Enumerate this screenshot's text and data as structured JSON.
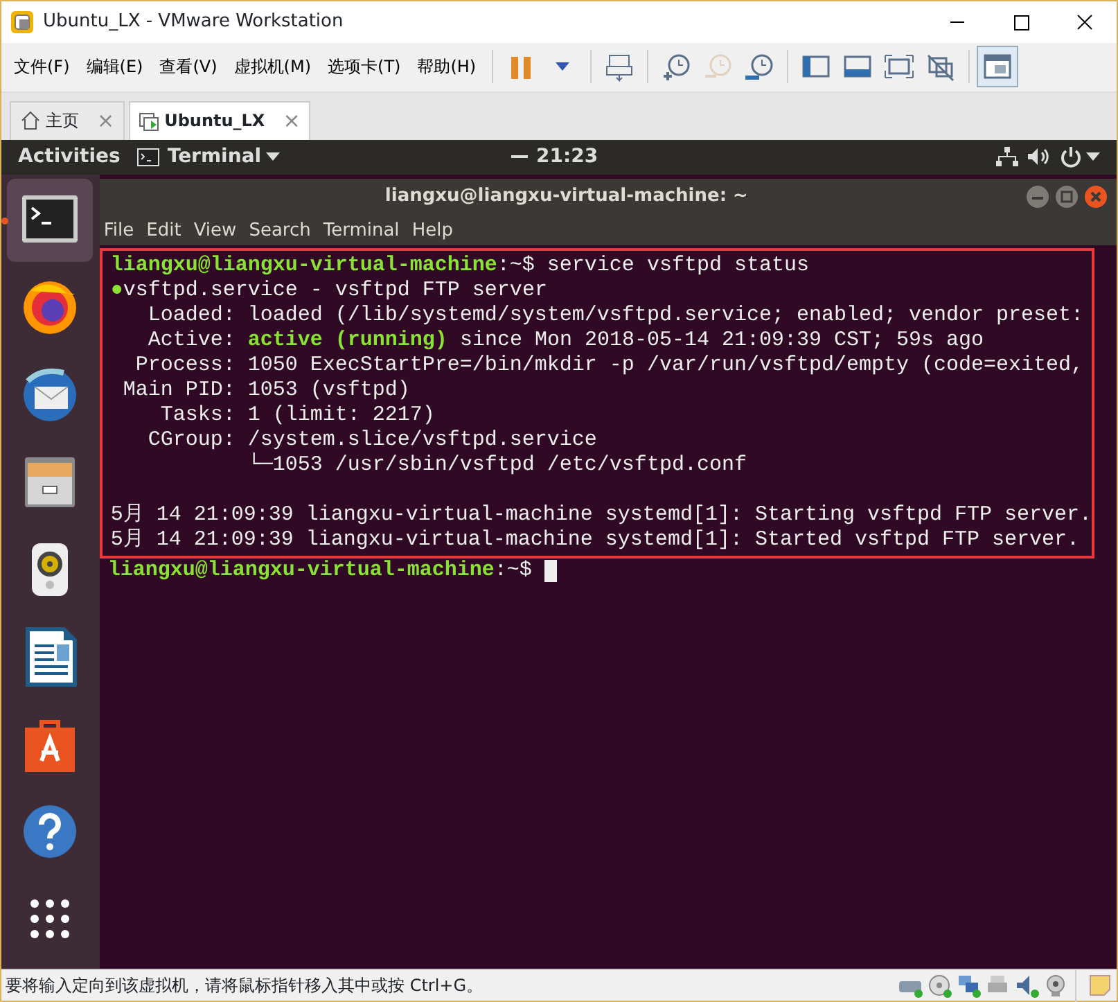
{
  "window": {
    "title": "Ubuntu_LX - VMware Workstation"
  },
  "menu": [
    "文件(F)",
    "编辑(E)",
    "查看(V)",
    "虚拟机(M)",
    "选项卡(T)",
    "帮助(H)"
  ],
  "toolbar": [
    {
      "kind": "pause",
      "disabled": false,
      "pressed": false
    },
    {
      "kind": "caret",
      "disabled": false,
      "pressed": false
    },
    {
      "kind": "send",
      "disabled": false,
      "pressed": false
    },
    {
      "kind": "snapshot",
      "disabled": false,
      "pressed": false
    },
    {
      "kind": "revert",
      "disabled": true,
      "pressed": false
    },
    {
      "kind": "manage",
      "disabled": false,
      "pressed": false
    },
    {
      "kind": "sidebar",
      "disabled": false,
      "pressed": false
    },
    {
      "kind": "console",
      "disabled": false,
      "pressed": false
    },
    {
      "kind": "fullscreen",
      "disabled": false,
      "pressed": false
    },
    {
      "kind": "unity",
      "disabled": false,
      "pressed": false
    },
    {
      "kind": "library",
      "disabled": false,
      "pressed": true
    }
  ],
  "tabs": [
    {
      "kind": "home",
      "label": "主页",
      "close": "×",
      "selected": false
    },
    {
      "kind": "vm",
      "label": "Ubuntu_LX",
      "close": "×",
      "selected": true
    }
  ],
  "topbar": {
    "activities": "Activities",
    "app": "Terminal",
    "clock": "21:23"
  },
  "dock": [
    {
      "kind": "terminal",
      "selected": true
    },
    {
      "kind": "firefox",
      "selected": false
    },
    {
      "kind": "mail",
      "selected": false
    },
    {
      "kind": "files",
      "selected": false
    },
    {
      "kind": "speaker",
      "selected": false
    },
    {
      "kind": "writer",
      "selected": false
    },
    {
      "kind": "store",
      "selected": false
    },
    {
      "kind": "help",
      "selected": false
    },
    {
      "kind": "grid",
      "selected": false
    }
  ],
  "terminal": {
    "title": "liangxu@liangxu-virtual-machine: ~",
    "menu": [
      "File",
      "Edit",
      "View",
      "Search",
      "Terminal",
      "Help"
    ],
    "highlighted": [
      {
        "kind": "text",
        "segments": [
          {
            "kind": "prompt",
            "text": "liangxu@liangxu-virtual-machine"
          },
          {
            "kind": "plain",
            "text": ":~$ service vsftpd status"
          }
        ]
      },
      {
        "kind": "text",
        "segments": [
          {
            "kind": "ok",
            "text": "●"
          },
          {
            "kind": "plain",
            "text": "vsftpd.service - vsftpd FTP server"
          }
        ]
      },
      {
        "kind": "text",
        "segments": [
          {
            "kind": "plain",
            "text": "   Loaded: loaded (/lib/systemd/system/vsftpd.service; enabled; vendor preset:"
          }
        ]
      },
      {
        "kind": "text",
        "segments": [
          {
            "kind": "plain",
            "text": "   Active: "
          },
          {
            "kind": "ok",
            "text": "active (running)"
          },
          {
            "kind": "plain",
            "text": " since Mon 2018-05-14 21:09:39 CST; 59s ago"
          }
        ]
      },
      {
        "kind": "text",
        "segments": [
          {
            "kind": "plain",
            "text": "  Process: 1050 ExecStartPre=/bin/mkdir -p /var/run/vsftpd/empty (code=exited,"
          }
        ]
      },
      {
        "kind": "text",
        "segments": [
          {
            "kind": "plain",
            "text": " Main PID: 1053 (vsftpd)"
          }
        ]
      },
      {
        "kind": "text",
        "segments": [
          {
            "kind": "plain",
            "text": "    Tasks: 1 (limit: 2217)"
          }
        ]
      },
      {
        "kind": "text",
        "segments": [
          {
            "kind": "plain",
            "text": "   CGroup: /system.slice/vsftpd.service"
          }
        ]
      },
      {
        "kind": "text",
        "segments": [
          {
            "kind": "plain",
            "text": "           └─1053 /usr/sbin/vsftpd /etc/vsftpd.conf"
          }
        ]
      },
      {
        "kind": "blank"
      },
      {
        "kind": "text",
        "segments": [
          {
            "kind": "plain",
            "text": "5月 14 21:09:39 liangxu-virtual-machine systemd[1]: Starting vsftpd FTP server."
          }
        ]
      },
      {
        "kind": "text",
        "segments": [
          {
            "kind": "plain",
            "text": "5月 14 21:09:39 liangxu-virtual-machine systemd[1]: Started vsftpd FTP server."
          }
        ]
      }
    ],
    "after": [
      {
        "kind": "text",
        "cursor": true,
        "segments": [
          {
            "kind": "prompt",
            "text": "liangxu@liangxu-virtual-machine"
          },
          {
            "kind": "plain",
            "text": ":~$"
          }
        ]
      }
    ]
  },
  "status_bar": {
    "text": "要将输入定向到该虚拟机，请将鼠标指针移入其中或按 Ctrl+G。"
  }
}
